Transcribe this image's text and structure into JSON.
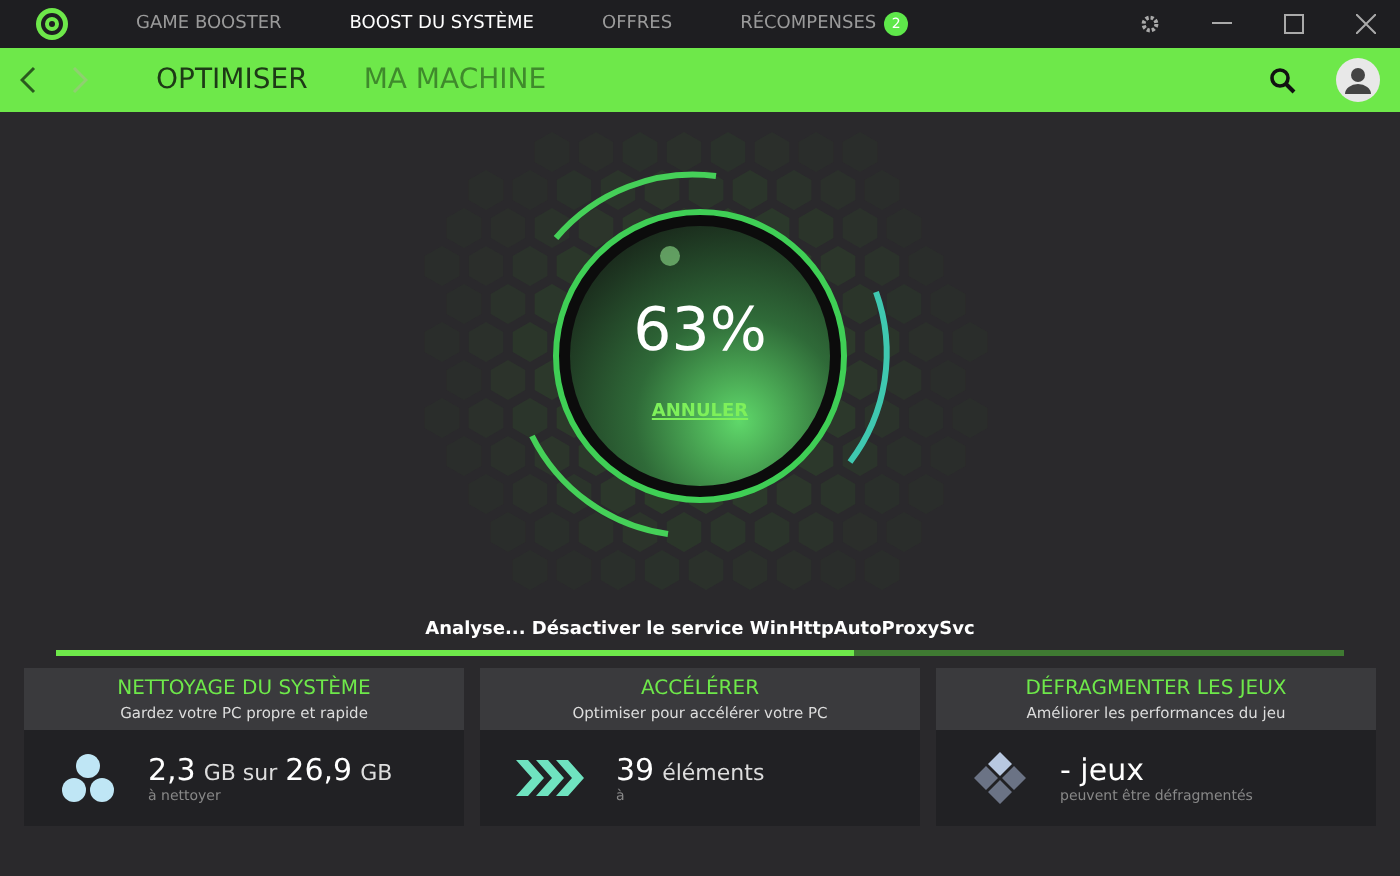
{
  "top_nav": [
    {
      "label": "GAME BOOSTER",
      "selected": false
    },
    {
      "label": "BOOST DU SYSTÈME",
      "selected": true
    },
    {
      "label": "OFFRES",
      "selected": false
    },
    {
      "label": "RÉCOMPENSES",
      "selected": false,
      "badge": "2"
    }
  ],
  "sub_nav": [
    {
      "label": "OPTIMISER",
      "selected": true
    },
    {
      "label": "MA MACHINE",
      "selected": false
    }
  ],
  "scan": {
    "percent": "63%",
    "cancel": "ANNULER",
    "status": "Analyse... Désactiver le service WinHttpAutoProxySvc",
    "level": 0.62
  },
  "cards": [
    {
      "kind": "cleanup",
      "title": "NETTOYAGE DU SYSTÈME",
      "subtitle": "Gardez votre PC propre et rapide",
      "value": "2,3",
      "unit": "GB sur",
      "value2": "26,9",
      "unit2": "GB",
      "note": "à nettoyer"
    },
    {
      "kind": "speed",
      "title": "ACCÉLÉRER",
      "subtitle": "Optimiser pour accélérer votre PC",
      "value": "39",
      "unit": "éléments",
      "note": "à"
    },
    {
      "kind": "defrag",
      "title": "DÉFRAGMENTER LES JEUX",
      "subtitle": "Améliorer les performances du jeu",
      "value": "- jeux",
      "note": "peuvent être défragmentés"
    }
  ]
}
